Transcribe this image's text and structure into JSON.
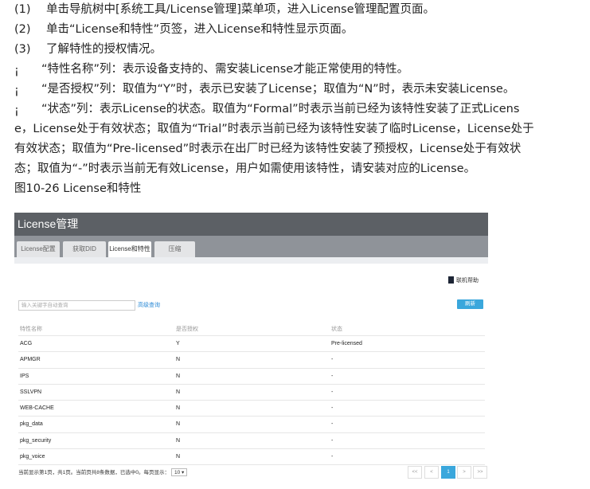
{
  "steps": [
    {
      "num": "(1)",
      "text": "单击导航树中[系统工具/License管理]菜单项，进入License管理配置页面。"
    },
    {
      "num": "(2)",
      "text": "单击“License和特性”页签，进入License和特性显示页面。"
    },
    {
      "num": "(3)",
      "text": "了解特性的授权情况。"
    }
  ],
  "bullet_mark": "¡",
  "bullets": [
    "“特性名称”列：表示设备支持的、需安装License才能正常使用的特性。",
    "“是否授权”列：取值为“Y”时，表示已安装了License；取值为“N”时，表示未安装License。"
  ],
  "status_lines": [
    "“状态”列：表示License的状态。取值为“Formal”时表示当前已经为该特性安装了正式Licens",
    "e，License处于有效状态；取值为“Trial”时表示当前已经为该特性安装了临时License，License处于",
    "有效状态；取值为“Pre-licensed”时表示在出厂时已经为该特性安装了预授权，License处于有效状",
    "态；取值为“-”时表示当前无有效License，用户如需使用该特性，请安装对应的License。"
  ],
  "figure_caption": "图10-26 License和特性",
  "screenshot": {
    "header_title": "License管理",
    "tabs": [
      "License配置",
      "获取DID",
      "License和特性",
      "压缩"
    ],
    "help_label": "联机帮助",
    "search_placeholder": "输入关键字自动查询",
    "advanced_query": "高级查询",
    "refresh_label": "刷新",
    "columns": [
      "特性名称",
      "是否授权",
      "状态"
    ],
    "rows": [
      [
        "ACG",
        "Y",
        "Pre-licensed"
      ],
      [
        "APMGR",
        "N",
        "-"
      ],
      [
        "IPS",
        "N",
        "-"
      ],
      [
        "SSLVPN",
        "N",
        "-"
      ],
      [
        "WEB-CACHE",
        "N",
        "-"
      ],
      [
        "pkg_data",
        "N",
        "-"
      ],
      [
        "pkg_security",
        "N",
        "-"
      ],
      [
        "pkg_voice",
        "N",
        "-"
      ]
    ],
    "pager_text": "当前显示第1页，共1页。当前页共8条数据，已选中0。每页显示：",
    "page_size": "10 ▾",
    "pager_buttons": [
      "<<",
      "<",
      "1",
      ">",
      ">>"
    ]
  }
}
